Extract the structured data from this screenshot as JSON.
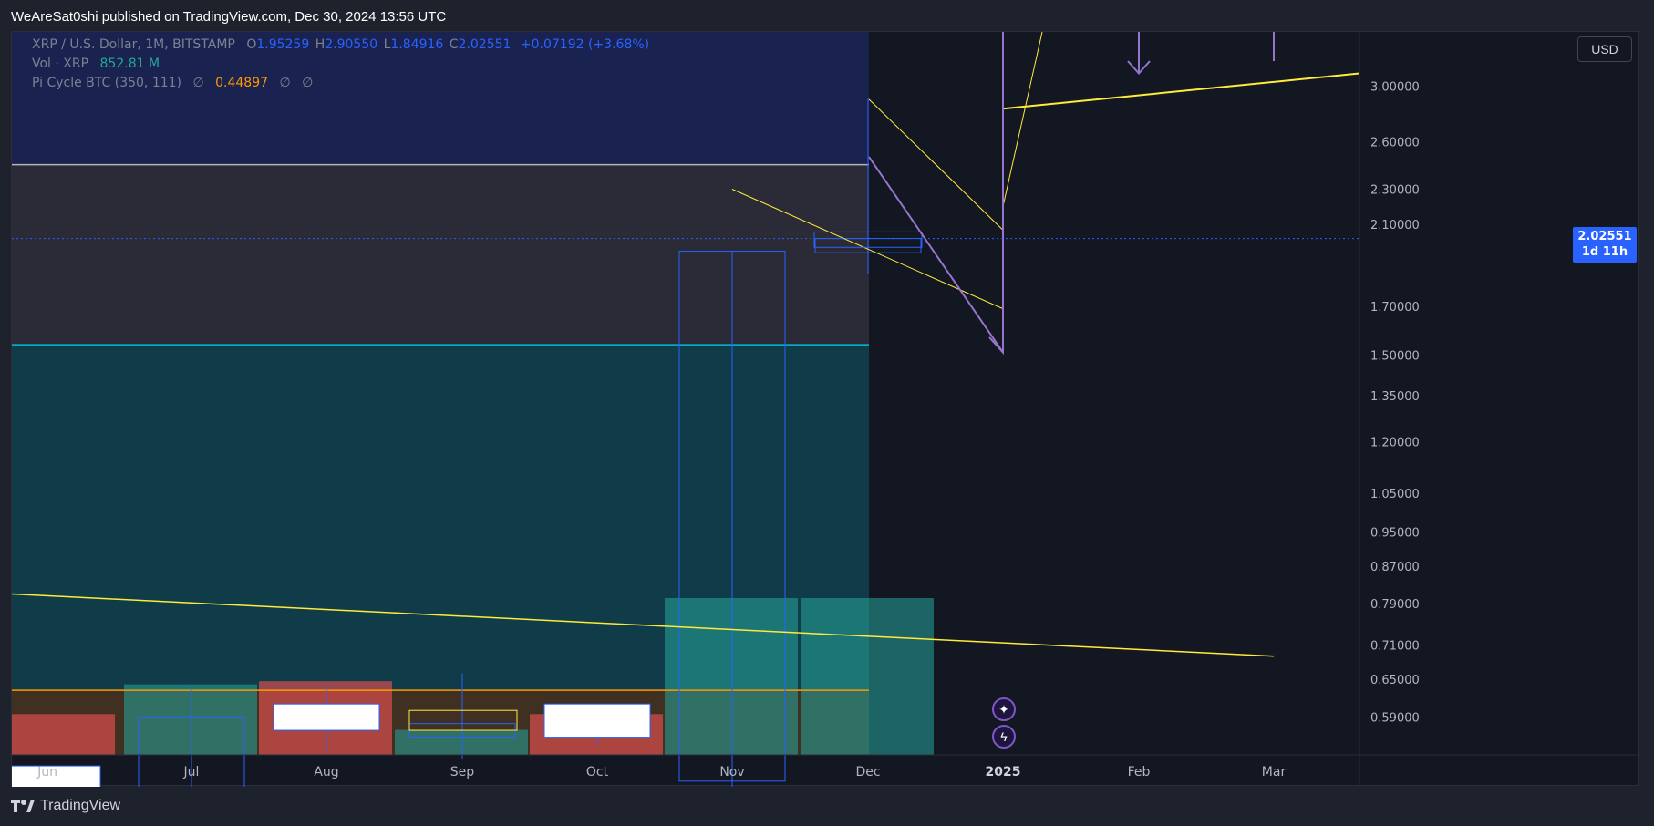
{
  "header": {
    "published_text": "WeAreSat0shi published on TradingView.com, Dec 30, 2024 13:56 UTC"
  },
  "legend": {
    "symbol": "XRP / U.S. Dollar, 1M, BITSTAMP",
    "open_label": "O",
    "open": "1.95259",
    "high_label": "H",
    "high": "2.90550",
    "low_label": "L",
    "low": "1.84916",
    "close_label": "C",
    "close": "2.02551",
    "change": "+0.07192 (+3.68%)",
    "vol_label": "Vol · XRP",
    "vol_value": "852.81 M",
    "indicator_label": "Pi Cycle BTC (350, 111)",
    "indicator_empty1": "∅",
    "indicator_value": "0.44897",
    "indicator_empty2": "∅",
    "indicator_empty3": "∅"
  },
  "price_scale": {
    "currency": "USD",
    "current_price": "2.02551",
    "countdown": "1d 11h"
  },
  "footer": {
    "brand": "TradingView"
  },
  "colors": {
    "background": "#131722",
    "accent_blue": "#2962ff",
    "teal": "#26a69a",
    "red": "#ef5350",
    "yellow": "#ffeb3b",
    "purple": "#9575cd",
    "orange": "#ff9800",
    "cyan": "#00bcd4"
  },
  "chart_data": {
    "type": "candlestick",
    "y_scale": "log",
    "ylim": [
      0.535,
      3.45
    ],
    "y_ticks": [
      "3.00000",
      "2.60000",
      "2.30000",
      "2.10000",
      "1.70000",
      "1.50000",
      "1.35000",
      "1.20000",
      "1.05000",
      "0.95000",
      "0.87000",
      "0.79000",
      "0.71000",
      "0.65000",
      "0.59000"
    ],
    "x_ticks": [
      "Jun",
      "Jul",
      "Aug",
      "Sep",
      "Oct",
      "Nov",
      "Dec",
      "2025",
      "Feb",
      "Mar"
    ],
    "candles": [
      {
        "month": "Jun",
        "open": 0.52,
        "high": 0.52,
        "low": 0.47,
        "close": 0.47
      },
      {
        "month": "Jul",
        "open": 0.47,
        "high": 0.64,
        "low": 0.47,
        "close": 0.59
      },
      {
        "month": "Aug",
        "open": 0.61,
        "high": 0.64,
        "low": 0.54,
        "close": 0.57
      },
      {
        "month": "Sep",
        "open": 0.56,
        "high": 0.66,
        "low": 0.53,
        "close": 0.58
      },
      {
        "month": "Oct",
        "open": 0.61,
        "high": 0.61,
        "low": 0.55,
        "close": 0.56
      },
      {
        "month": "Nov",
        "open": 0.5,
        "high": 1.96,
        "low": 0.49,
        "close": 1.96
      },
      {
        "month": "Dec",
        "open": 1.95259,
        "high": 2.9055,
        "low": 1.84916,
        "close": 2.02551
      }
    ],
    "volume": [
      {
        "month": "Jun",
        "direction": "down",
        "level": 0.26
      },
      {
        "month": "Jul",
        "direction": "up",
        "level": 0.45
      },
      {
        "month": "Aug",
        "direction": "down",
        "level": 0.47
      },
      {
        "month": "Sep",
        "direction": "up",
        "level": 0.16
      },
      {
        "month": "Oct",
        "direction": "down",
        "level": 0.26
      },
      {
        "month": "Nov",
        "direction": "up",
        "level": 1.0
      },
      {
        "month": "Dec",
        "direction": "up",
        "level": 1.0
      }
    ],
    "horizontal_levels": [
      {
        "price": 2.45,
        "color": "#b2b5be"
      },
      {
        "price": 1.54,
        "color": "#00bcd4"
      },
      {
        "price": 0.632,
        "color": "#ff9800"
      }
    ],
    "last_price": 2.02551
  }
}
